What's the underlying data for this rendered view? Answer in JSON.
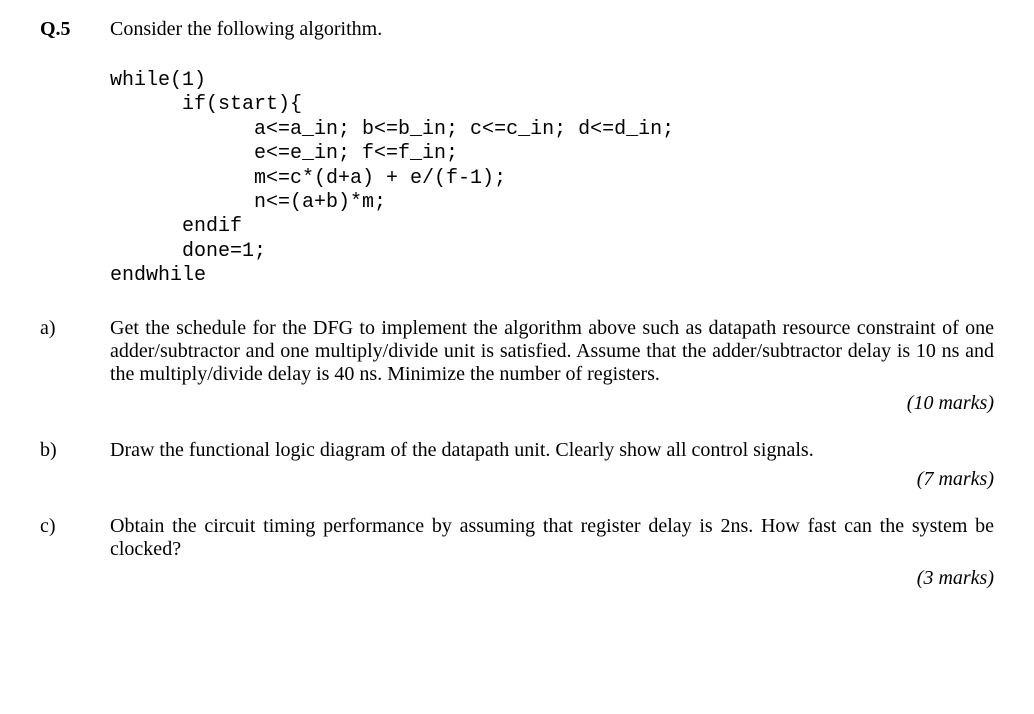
{
  "question": {
    "number": "Q.5",
    "prompt": "Consider the following algorithm."
  },
  "code": {
    "l1": "while(1)",
    "l2": "      if(start){",
    "l3": "            a<=a_in; b<=b_in; c<=c_in; d<=d_in;",
    "l4": "            e<=e_in; f<=f_in;",
    "l5": "            m<=c*(d+a) + e/(f-1);",
    "l6": "            n<=(a+b)*m;",
    "l7": "      endif",
    "l8": "      done=1;",
    "l9": "endwhile"
  },
  "parts": {
    "a": {
      "label": "a)",
      "text": "Get the schedule for the DFG to implement the algorithm above such as datapath resource constraint of one adder/subtractor and one multiply/divide unit is satisfied. Assume that the adder/subtractor delay is 10 ns and the multiply/divide delay is 40 ns. Minimize the number of registers.",
      "marks": "(10 marks)"
    },
    "b": {
      "label": "b)",
      "text": "Draw the functional logic diagram of the datapath unit. Clearly show all control signals.",
      "marks": "(7 marks)"
    },
    "c": {
      "label": "c)",
      "text": "Obtain the circuit timing performance by assuming that register delay is 2ns. How fast can the system be clocked?",
      "marks": "(3 marks)"
    }
  }
}
